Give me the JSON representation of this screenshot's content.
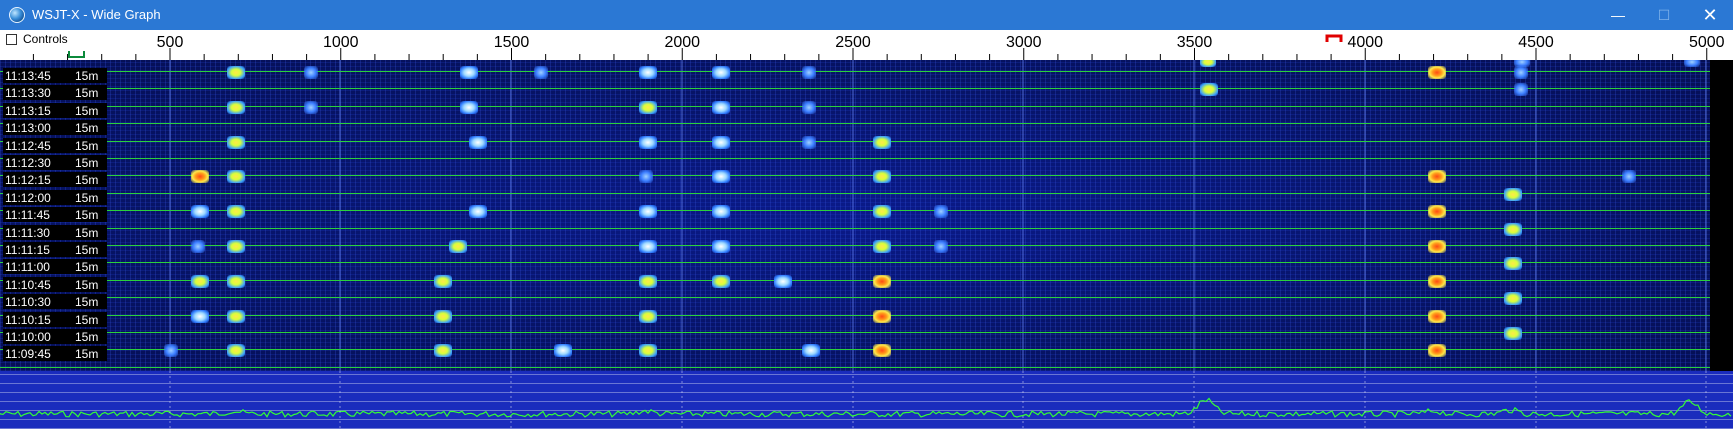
{
  "window": {
    "title": "WSJT-X - Wide Graph",
    "min_glyph": "—",
    "max_glyph": "☐",
    "close_glyph": "✕"
  },
  "toolbar": {
    "controls_label": "Controls",
    "controls_checked": false,
    "freq_ticks": [
      "500",
      "1000",
      "1500",
      "2000",
      "2500",
      "3000",
      "3500",
      "4000",
      "4500",
      "5000"
    ],
    "tx_marker_color": "#e00000",
    "rx_marker_color": "#0b8a3b"
  },
  "waterfall": {
    "rows": [
      {
        "time": "11:13:45",
        "period": "15m"
      },
      {
        "time": "11:13:30",
        "period": "15m"
      },
      {
        "time": "11:13:15",
        "period": "15m"
      },
      {
        "time": "11:13:00",
        "period": "15m"
      },
      {
        "time": "11:12:45",
        "period": "15m"
      },
      {
        "time": "11:12:30",
        "period": "15m"
      },
      {
        "time": "11:12:15",
        "period": "15m"
      },
      {
        "time": "11:12:00",
        "period": "15m"
      },
      {
        "time": "11:11:45",
        "period": "15m"
      },
      {
        "time": "11:11:30",
        "period": "15m"
      },
      {
        "time": "11:11:15",
        "period": "15m"
      },
      {
        "time": "11:11:00",
        "period": "15m"
      },
      {
        "time": "11:10:45",
        "period": "15m"
      },
      {
        "time": "11:10:30",
        "period": "15m"
      },
      {
        "time": "11:10:15",
        "period": "15m"
      },
      {
        "time": "11:10:00",
        "period": "15m"
      },
      {
        "time": "11:09:45",
        "period": "15m"
      }
    ],
    "separator_color": "#2ad13c"
  },
  "spectrum": {
    "trace_color": "#33ff33",
    "background_color": "#1a2cbd"
  }
}
